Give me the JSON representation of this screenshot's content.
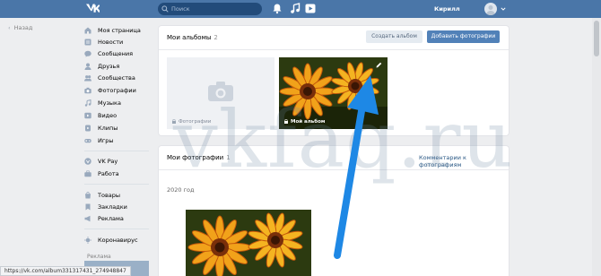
{
  "header": {
    "search_placeholder": "Поиск",
    "user_name": "Кирилл",
    "icons": [
      "vk-logo-icon",
      "bell-icon",
      "music-icon",
      "video-icon"
    ],
    "bg_color": "#4a76a8"
  },
  "nav": {
    "back_label": "Назад"
  },
  "sidebar": {
    "group1": [
      {
        "label": "Моя страница",
        "icon": "home-icon"
      },
      {
        "label": "Новости",
        "icon": "news-icon"
      },
      {
        "label": "Сообщения",
        "icon": "message-icon"
      },
      {
        "label": "Друзья",
        "icon": "user-icon"
      },
      {
        "label": "Сообщества",
        "icon": "users-icon"
      },
      {
        "label": "Фотографии",
        "icon": "camera-icon"
      },
      {
        "label": "Музыка",
        "icon": "music-icon"
      },
      {
        "label": "Видео",
        "icon": "video-icon"
      },
      {
        "label": "Клипы",
        "icon": "clips-icon"
      },
      {
        "label": "Игры",
        "icon": "games-icon"
      }
    ],
    "group2": [
      {
        "label": "VK Pay",
        "icon": "vkpay-icon"
      },
      {
        "label": "Работа",
        "icon": "briefcase-icon"
      }
    ],
    "group3": [
      {
        "label": "Товары",
        "icon": "shop-icon"
      },
      {
        "label": "Закладки",
        "icon": "bookmark-icon"
      },
      {
        "label": "Реклама",
        "icon": "megaphone-icon"
      }
    ],
    "group4": [
      {
        "label": "Коронавирус",
        "icon": "virus-icon"
      }
    ],
    "ad_label": "Реклама"
  },
  "albums": {
    "title": "Мои альбомы",
    "count": "2",
    "create_button": "Создать альбом",
    "add_button": "Добавить фотографии",
    "items": [
      {
        "label": "Фотографии"
      },
      {
        "label": "Мой альбом"
      }
    ]
  },
  "photos": {
    "title": "Мои фотографии",
    "count": "1",
    "comments_link": "Комментарии к фотографиям",
    "year": "2020 год"
  },
  "status_bar": {
    "url": "https://vk.com/album331317431_274948847"
  },
  "watermark": {
    "text": "vkfaq.ru"
  },
  "colors": {
    "accent": "#5181b8",
    "arrow": "#1e88e5",
    "background": "#edeef0"
  }
}
